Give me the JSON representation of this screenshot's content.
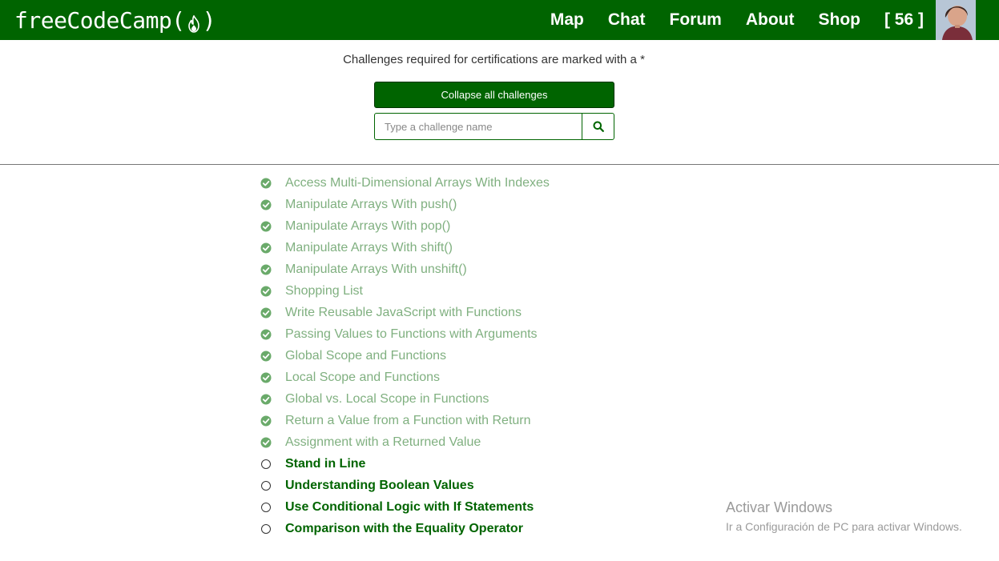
{
  "navbar": {
    "brand": "freeCodeCamp",
    "brand_open": "(",
    "brand_close": ")",
    "links": [
      {
        "label": "Map"
      },
      {
        "label": "Chat"
      },
      {
        "label": "Forum"
      },
      {
        "label": "About"
      },
      {
        "label": "Shop"
      },
      {
        "label": "[ 56 ]"
      }
    ],
    "icons": {
      "brand": "flame-icon",
      "avatar": "user-avatar"
    }
  },
  "header": {
    "note": "Challenges required for certifications are marked with a *",
    "collapse_label": "Collapse all challenges",
    "search_placeholder": "Type a challenge name",
    "search_icon": "search-icon"
  },
  "challenges": [
    {
      "title": "Access Multi-Dimensional Arrays With Indexes",
      "done": true
    },
    {
      "title": "Manipulate Arrays With push()",
      "done": true
    },
    {
      "title": "Manipulate Arrays With pop()",
      "done": true
    },
    {
      "title": "Manipulate Arrays With shift()",
      "done": true
    },
    {
      "title": "Manipulate Arrays With unshift()",
      "done": true
    },
    {
      "title": "Shopping List",
      "done": true
    },
    {
      "title": "Write Reusable JavaScript with Functions",
      "done": true
    },
    {
      "title": "Passing Values to Functions with Arguments",
      "done": true
    },
    {
      "title": "Global Scope and Functions",
      "done": true
    },
    {
      "title": "Local Scope and Functions",
      "done": true
    },
    {
      "title": "Global vs. Local Scope in Functions",
      "done": true
    },
    {
      "title": "Return a Value from a Function with Return",
      "done": true
    },
    {
      "title": "Assignment with a Returned Value",
      "done": true
    },
    {
      "title": "Stand in Line",
      "done": false
    },
    {
      "title": "Understanding Boolean Values",
      "done": false
    },
    {
      "title": "Use Conditional Logic with If Statements",
      "done": false
    },
    {
      "title": "Comparison with the Equality Operator",
      "done": false
    }
  ],
  "colors": {
    "brand_green": "#006400",
    "done_text": "#80b080",
    "done_check": "#6aaa6a",
    "todo_text": "#006400"
  },
  "watermark": {
    "title": "Activar Windows",
    "subtitle": "Ir a Configuración de PC para activar Windows."
  }
}
